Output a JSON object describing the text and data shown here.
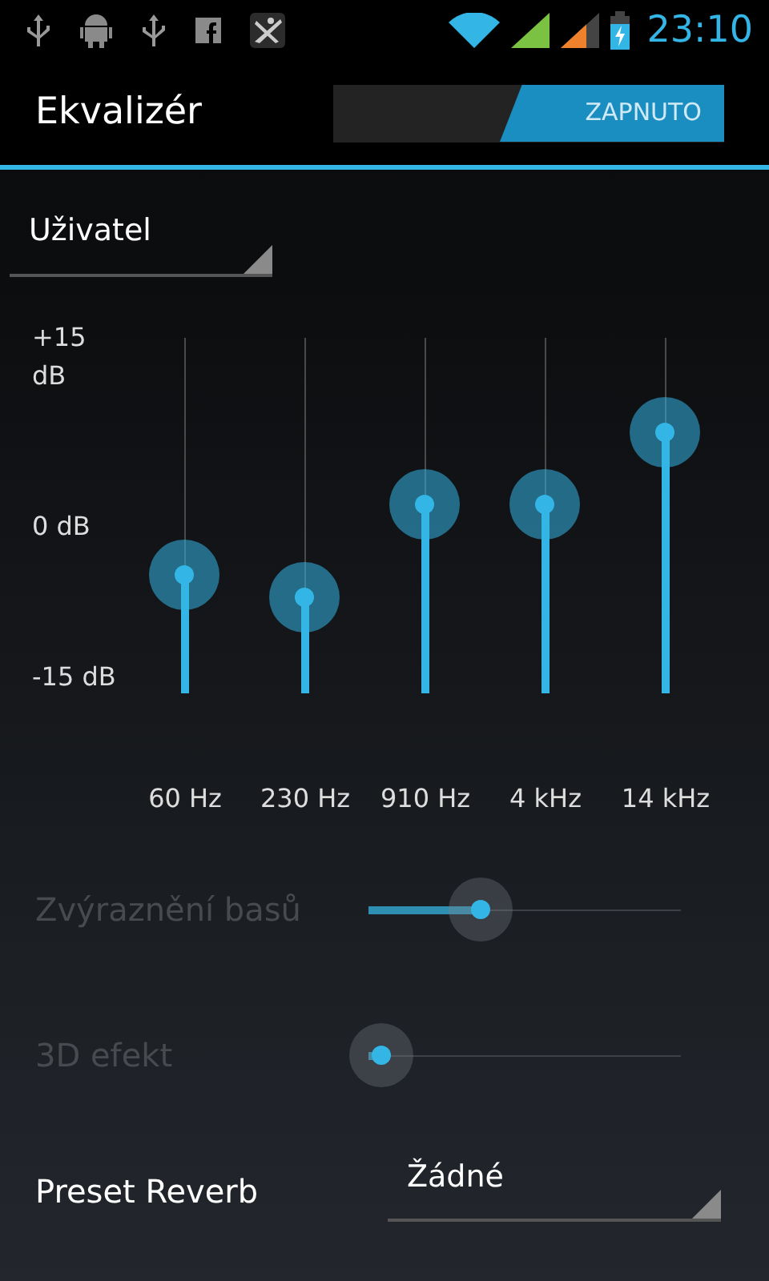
{
  "status_bar": {
    "time": "23:10"
  },
  "action_bar": {
    "title": "Ekvalizér",
    "toggle": {
      "label": "ZAPNUTO",
      "on": true
    }
  },
  "preset_spinner": {
    "value": "Uživatel"
  },
  "equalizer": {
    "scale": [
      "+15 dB",
      "0 dB",
      "-15 dB"
    ],
    "bands": [
      {
        "label": "60 Hz",
        "level": 0.33
      },
      {
        "label": "230 Hz",
        "level": 0.27
      },
      {
        "label": "910 Hz",
        "level": 0.53
      },
      {
        "label": "4 kHz",
        "level": 0.53
      },
      {
        "label": "14 kHz",
        "level": 0.73
      }
    ]
  },
  "effects": [
    {
      "label": "Zvýraznění basů",
      "level": 0.36,
      "disabled": true
    },
    {
      "label": "3D efekt",
      "level": 0.04,
      "disabled": true
    }
  ],
  "reverb": {
    "label": "Preset Reverb",
    "value": "Žádné"
  }
}
